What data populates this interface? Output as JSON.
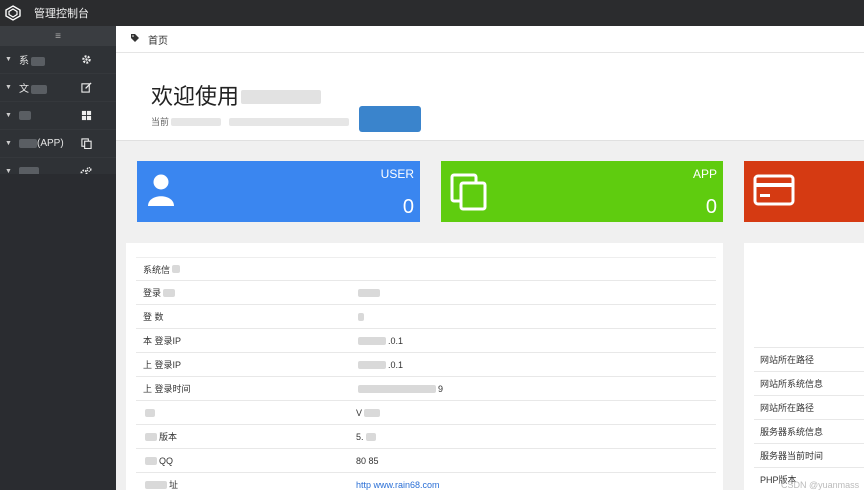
{
  "app": {
    "title": "管理控制台"
  },
  "sidebar": {
    "toggle_icon": "hamburger-icon",
    "items": [
      {
        "label": "系",
        "icon": "gear-icon"
      },
      {
        "label": "文",
        "icon": "edit-icon"
      },
      {
        "label": "",
        "icon": "grid-icon"
      },
      {
        "label": "(APP)",
        "icon": "copy-icon"
      },
      {
        "label": "",
        "icon": "gears-icon"
      }
    ]
  },
  "breadcrumb": {
    "home_label": "首页",
    "icon": "tag-icon"
  },
  "welcome": {
    "title": "欢迎使用",
    "subtitle": "当前"
  },
  "cards": [
    {
      "label": "USER",
      "value": "0",
      "icon": "user-icon",
      "color": "#3a86f0"
    },
    {
      "label": "APP",
      "value": "0",
      "icon": "copy-icon",
      "color": "#5fcc0f"
    },
    {
      "label": "",
      "value": "",
      "icon": "credit-card-icon",
      "color": "#d53a12"
    }
  ],
  "info_table": {
    "title": "系统信",
    "rows": [
      {
        "key": "登录",
        "value": ""
      },
      {
        "key": "登   数",
        "value": ""
      },
      {
        "key": "本   登录IP",
        "value": ".0.1"
      },
      {
        "key": "上   登录IP",
        "value": ".0.1"
      },
      {
        "key": "上   登录时间",
        "value": "9"
      },
      {
        "key": "",
        "value": "V"
      },
      {
        "key": "版本",
        "value": "5."
      },
      {
        "key": "QQ",
        "value": "80     85"
      },
      {
        "key": "址",
        "value": "http   www.rain68.com"
      }
    ]
  },
  "right_panel": {
    "rows": [
      "网站所在路径",
      "网站所系统信息",
      "网站所在路径",
      "服务器系统信息",
      "服务器当前时间",
      "PHP版本"
    ]
  },
  "watermark": "CSDN @yuanmass"
}
